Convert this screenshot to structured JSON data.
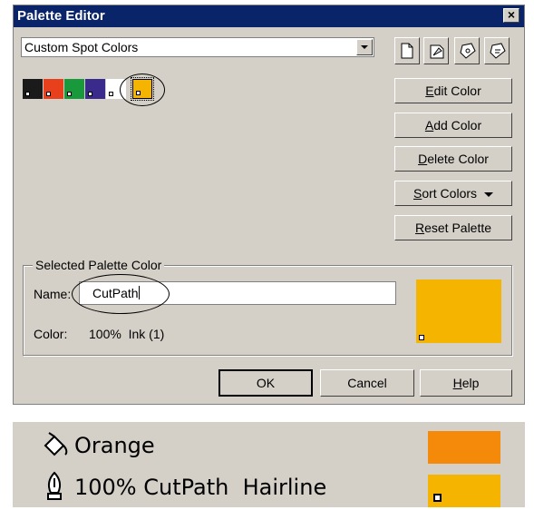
{
  "dialog": {
    "title": "Palette Editor",
    "close_glyph": "×",
    "palette_select": {
      "value": "Custom Spot Colors"
    },
    "toolbar_icons": [
      "new-palette-icon",
      "open-palette-icon",
      "save-palette-icon",
      "save-as-palette-icon"
    ],
    "swatches": [
      {
        "color": "#1a1a1a"
      },
      {
        "color": "#e8401c"
      },
      {
        "color": "#189a3c"
      },
      {
        "color": "#3a2a8c"
      },
      {
        "color": "#ffffff"
      },
      {
        "color": "#f5b400",
        "selected": true
      }
    ],
    "buttons": {
      "edit_color": {
        "key": "E",
        "rest": "dit Color"
      },
      "add_color": {
        "key": "A",
        "rest": "dd Color"
      },
      "delete_color": {
        "key": "D",
        "rest": "elete Color"
      },
      "sort_colors": {
        "key": "S",
        "rest": "ort Colors"
      },
      "reset_palette": {
        "key": "R",
        "rest": "eset Palette"
      }
    },
    "selected_group": {
      "legend": "Selected Palette Color",
      "name_label": "Name:",
      "name_value": "CutPath",
      "color_label": "Color:",
      "color_value": "100%  Ink (1)",
      "preview_color": "#f5b400"
    },
    "footer": {
      "ok": "OK",
      "cancel": "Cancel",
      "help_key": "H",
      "help_rest": "elp"
    }
  },
  "properties": {
    "fill_row": {
      "icon": "fill-bucket-icon",
      "label": "Orange",
      "color": "#f58a0a"
    },
    "outline_row": {
      "icon": "pen-nib-icon",
      "label": "100% CutPath  Hairline",
      "color": "#f5b400"
    }
  }
}
